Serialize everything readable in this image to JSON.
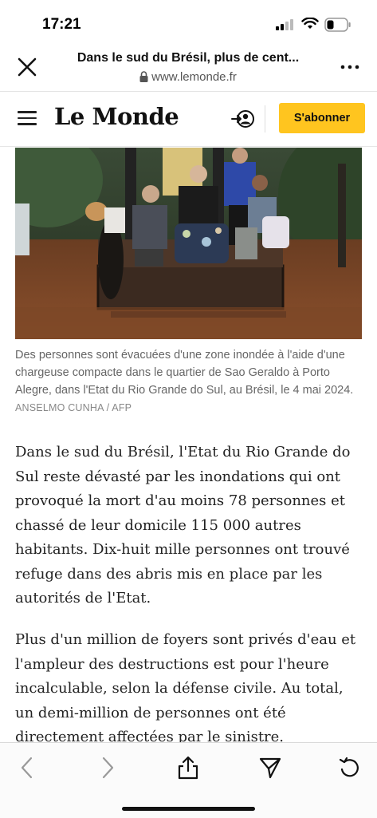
{
  "status_bar": {
    "time": "17:21"
  },
  "browser": {
    "page_title": "Dans le sud du Brésil, plus de cent...",
    "url": "www.lemonde.fr"
  },
  "site_header": {
    "logo": "Le Monde",
    "subscribe_label": "S'abonner"
  },
  "photo": {
    "caption": "Des personnes sont évacuées d'une zone inondée à l'aide d'une chargeuse compacte dans le quartier de Sao Geraldo à Porto Alegre, dans l'Etat du Rio Grande do Sul, au Brésil, le 4 mai 2024.",
    "credit": "ANSELMO CUNHA / AFP"
  },
  "article": {
    "paragraphs": [
      "Dans le sud du Brésil, l'Etat du Rio Grande do Sul reste dévasté par les inondations qui ont provoqué la mort d'au moins 78 personnes et chassé de leur domicile 115 000 autres habitants. Dix-huit mille personnes ont trouvé refuge dans des abris mis en place par les autorités de l'Etat.",
      "Plus d'un million de foyers sont privés d'eau et l'ampleur des destructions est pour l'heure incalculable, selon la défense civile. Au total, un demi-million de personnes ont été directement affectées par le sinistre."
    ]
  },
  "icons": {
    "close": "close-icon",
    "more": "more-icon",
    "menu": "menu-icon",
    "account": "account-login-icon",
    "back": "chevron-left-icon",
    "forward": "chevron-right-icon",
    "share": "share-icon",
    "send": "send-icon",
    "reload": "reload-icon"
  },
  "colors": {
    "subscribe_bg": "#ffc51f",
    "text": "#222222",
    "caption": "#666666"
  }
}
